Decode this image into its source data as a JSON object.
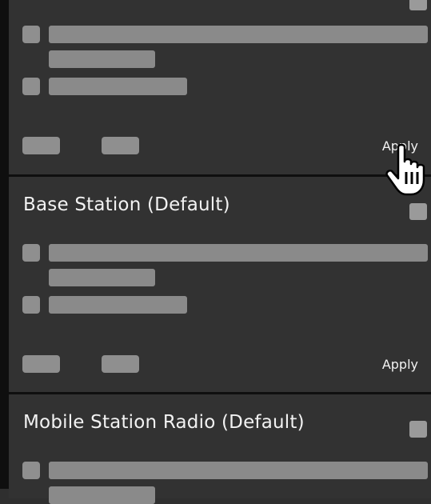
{
  "cards": [
    {
      "title": "",
      "apply_label": "Apply"
    },
    {
      "title": "Base Station (Default)",
      "apply_label": "Apply"
    },
    {
      "title": "Mobile Station Radio (Default)",
      "apply_label": ""
    }
  ],
  "colors": {
    "background": "#0f0f0f",
    "card": "#323232",
    "placeholder": "#8a8a8a",
    "text": "#f2f2f2"
  },
  "icons": {
    "cursor": "hand-pointer-icon"
  }
}
